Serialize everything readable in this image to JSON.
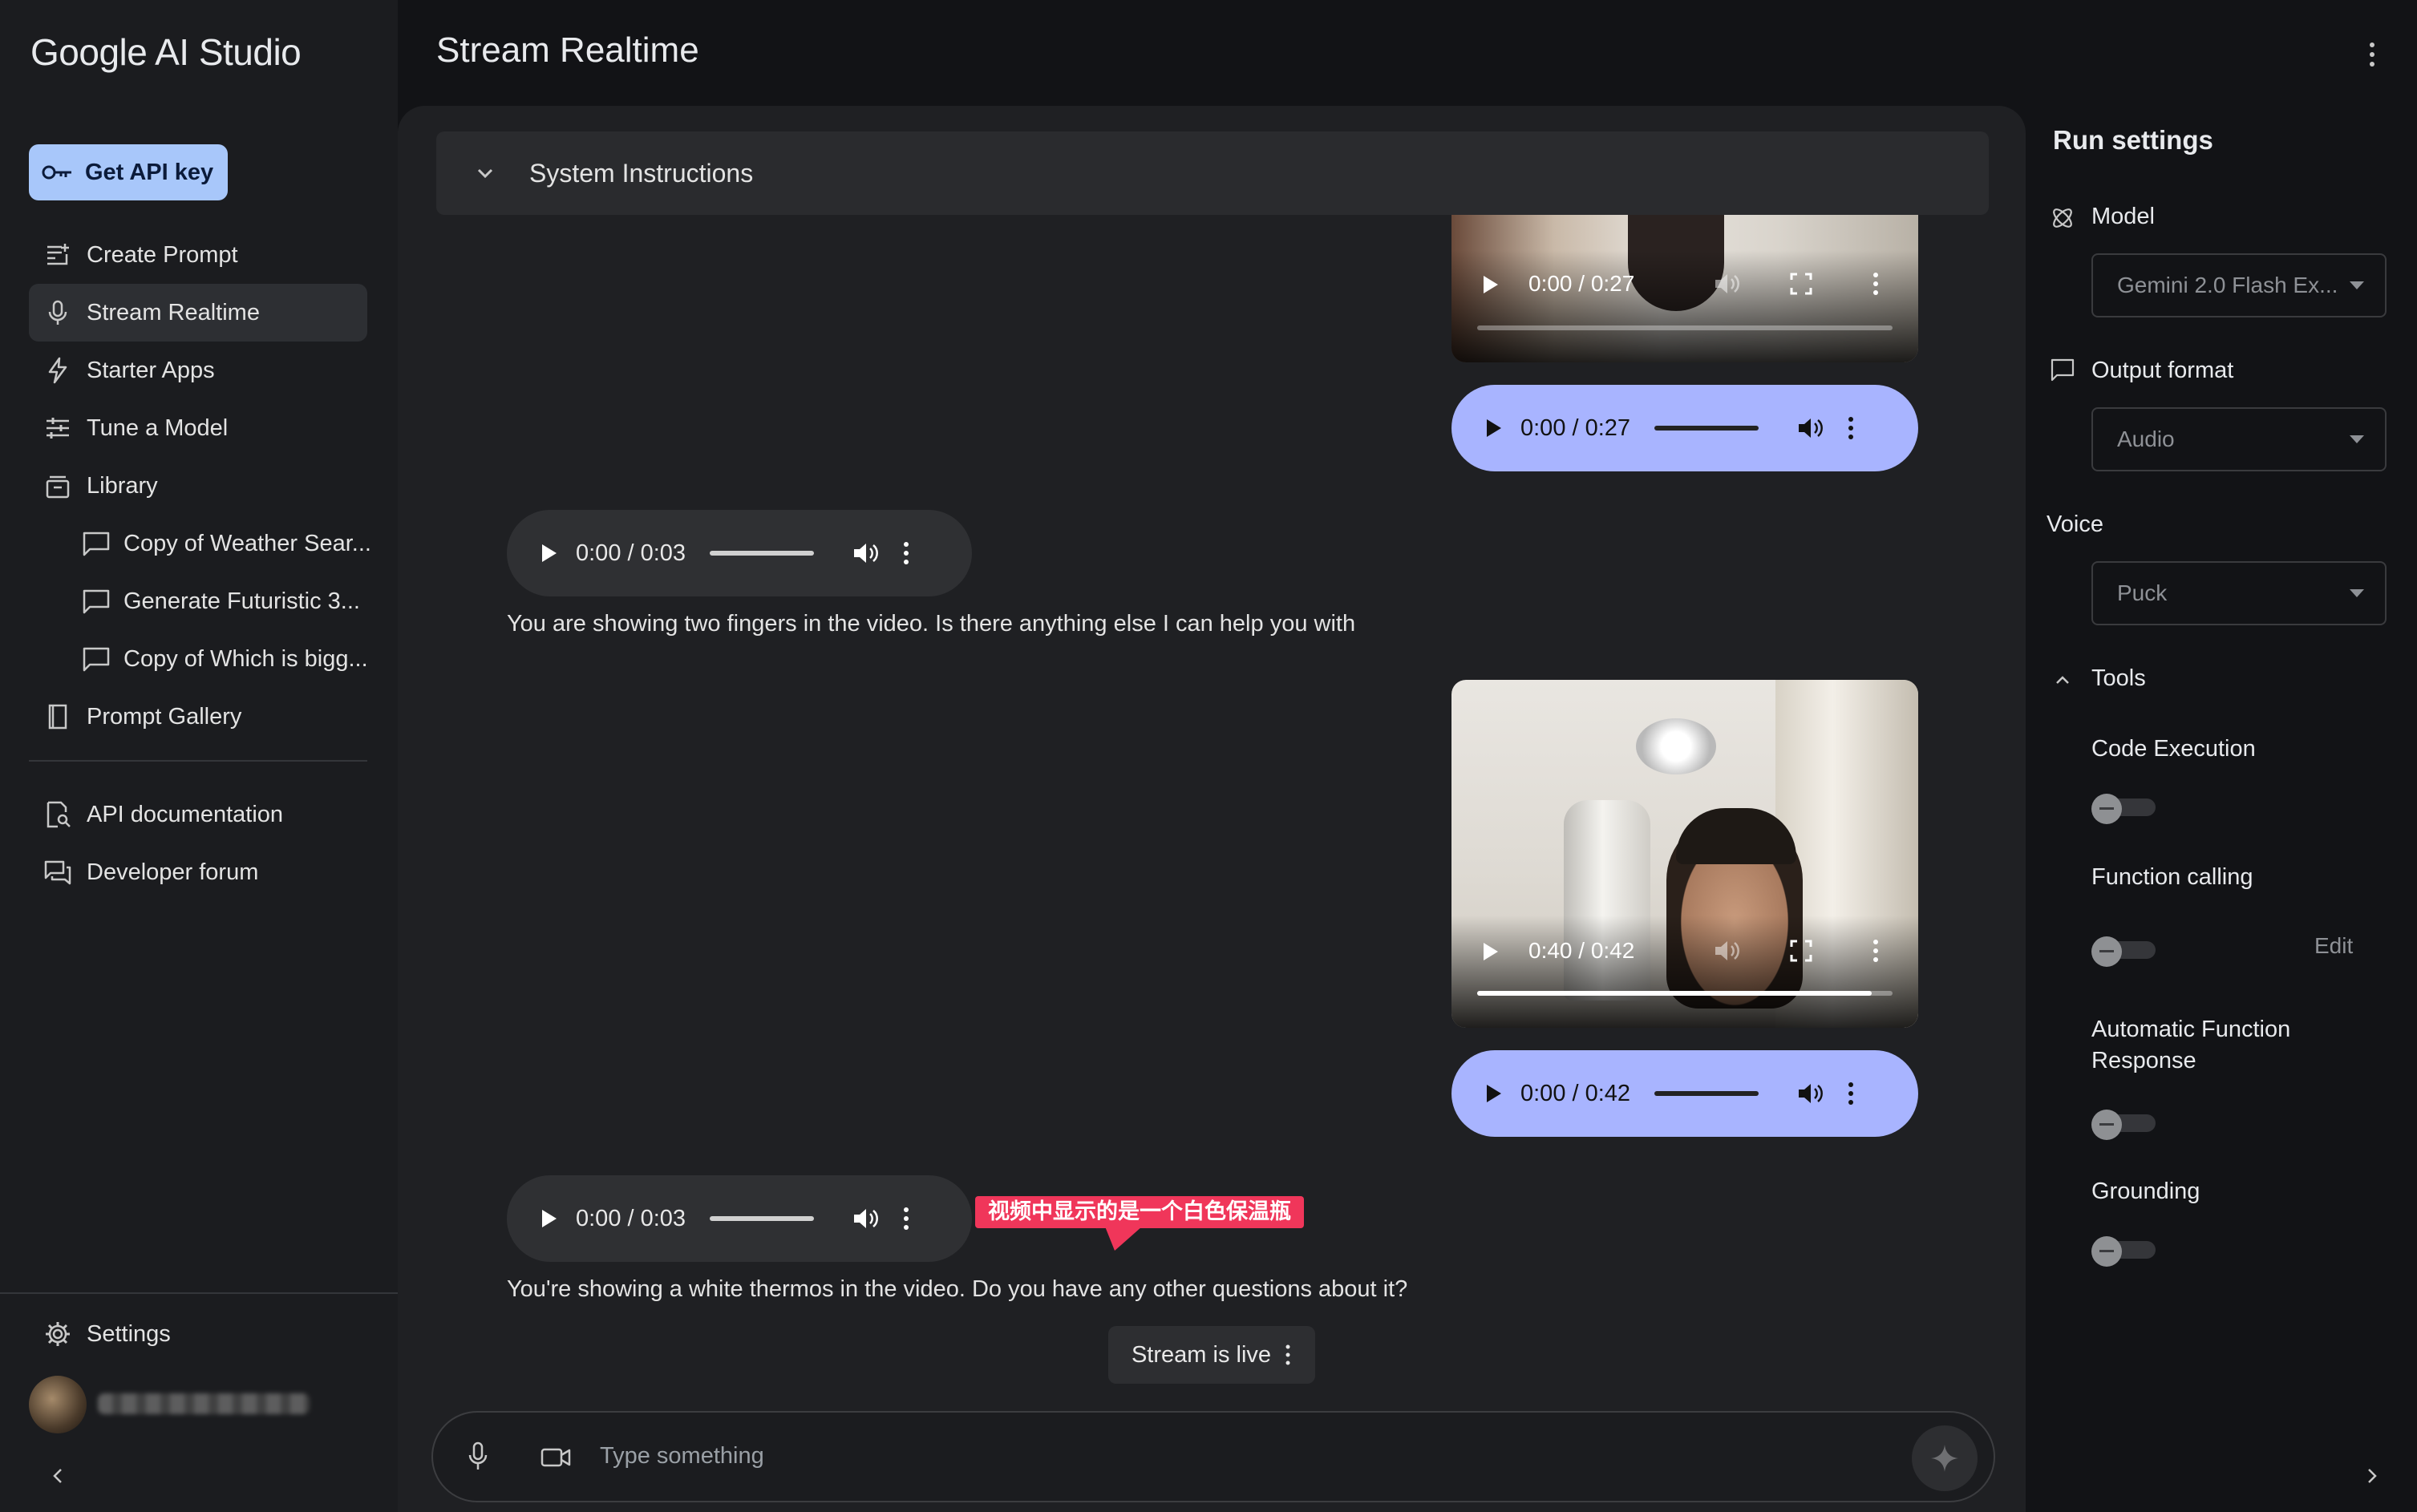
{
  "app": {
    "brand": "Google AI Studio",
    "page_title": "Stream Realtime"
  },
  "sidebar": {
    "api_key_label": "Get API key",
    "items": [
      {
        "label": "Create Prompt",
        "icon": "create-prompt-icon"
      },
      {
        "label": "Stream Realtime",
        "icon": "microphone-icon",
        "active": true
      },
      {
        "label": "Starter Apps",
        "icon": "bolt-icon"
      },
      {
        "label": "Tune a Model",
        "icon": "tune-icon"
      },
      {
        "label": "Library",
        "icon": "library-icon"
      }
    ],
    "library_items": [
      "Copy of Weather Sear...",
      "Generate Futuristic 3...",
      "Copy of Which is bigg..."
    ],
    "prompt_gallery": "Prompt Gallery",
    "links": [
      "API documentation",
      "Developer forum"
    ],
    "settings": "Settings"
  },
  "chat": {
    "system_instructions": "System Instructions",
    "video1": {
      "time": "0:00 / 0:27",
      "progress": 0.0
    },
    "audio1": {
      "time": "0:00 / 0:27"
    },
    "reply1_audio": {
      "time": "0:00 / 0:03"
    },
    "reply1_text": "You are showing two fingers in the video. Is there anything else I can help you with",
    "video2": {
      "time": "0:40 / 0:42",
      "progress": 0.95
    },
    "audio2": {
      "time": "0:00 / 0:42"
    },
    "reply2_audio": {
      "time": "0:00 / 0:03"
    },
    "annotation": "视频中显示的是一个白色保温瓶",
    "reply2_text": "You're showing a white thermos in the video. Do you have any other questions about it?",
    "stream_status": "Stream is live",
    "input_placeholder": "Type something"
  },
  "run_settings": {
    "title": "Run settings",
    "model_label": "Model",
    "model_value": "Gemini 2.0 Flash Ex...",
    "output_label": "Output format",
    "output_value": "Audio",
    "voice_label": "Voice",
    "voice_value": "Puck",
    "tools_label": "Tools",
    "code_execution": "Code Execution",
    "function_calling": "Function calling",
    "edit": "Edit",
    "auto_function_line1": "Automatic Function",
    "auto_function_line2": "Response",
    "grounding": "Grounding"
  },
  "colors": {
    "accent": "#a8c7fa",
    "user_audio": "#a8b4ff",
    "annotation": "#f0365a"
  }
}
